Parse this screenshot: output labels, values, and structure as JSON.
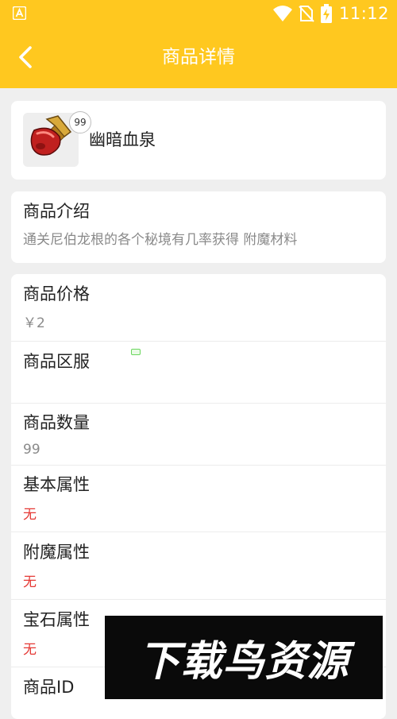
{
  "status_bar": {
    "time": "11:12",
    "app_icon": "app-a-icon",
    "icons": [
      "wifi-icon",
      "no-sim-icon",
      "battery-charging-icon"
    ]
  },
  "header": {
    "title": "商品详情",
    "back_icon": "chevron-left-icon"
  },
  "product": {
    "name": "幽暗血泉",
    "quantity_badge": "99"
  },
  "intro": {
    "label": "商品介绍",
    "text": "通关尼伯龙根的各个秘境有几率获得 附魔材料"
  },
  "details": [
    {
      "label": "商品价格",
      "value": "￥2"
    },
    {
      "label": "商品区服",
      "value": ""
    },
    {
      "label": "商品数量",
      "value": "99"
    },
    {
      "label": "基本属性",
      "value": "无"
    },
    {
      "label": "附魔属性",
      "value": "无"
    },
    {
      "label": "宝石属性",
      "value": "无"
    },
    {
      "label": "商品ID",
      "value": ""
    }
  ],
  "watermark": {
    "text": "下载鸟资源"
  },
  "colors": {
    "accent": "#ffc81f",
    "value_red": "#e53935",
    "value_gray": "#8a8a8a"
  }
}
